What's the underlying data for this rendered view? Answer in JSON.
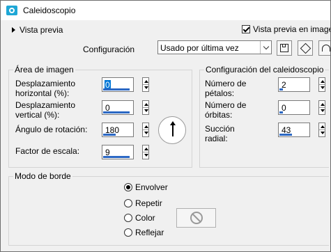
{
  "window": {
    "title": "Caleidoscopio"
  },
  "top": {
    "preview_label": "Vista previa",
    "preview_checkbox_label": "Vista previa en imagen",
    "preview_checked": true
  },
  "config": {
    "label": "Configuración",
    "selected": "Usado por última vez",
    "icons": [
      "save-icon",
      "cube-icon",
      "reset-icon"
    ]
  },
  "image_area": {
    "title": "Área de imagen",
    "fields": [
      {
        "label": "Desplazamiento horizontal (%):",
        "value": "0"
      },
      {
        "label": "Desplazamiento vertical (%):",
        "value": "0"
      },
      {
        "label": "Ángulo de rotación:",
        "value": "180"
      },
      {
        "label": "Factor de escala:",
        "value": "9"
      }
    ]
  },
  "kaleido": {
    "title": "Configuración del caleidoscopio",
    "fields": [
      {
        "label": "Número de pétalos:",
        "value": "2"
      },
      {
        "label": "Número de órbitas:",
        "value": "0"
      },
      {
        "label": "Succión radial:",
        "value": "43"
      }
    ]
  },
  "border": {
    "title": "Modo de borde",
    "options": [
      "Envolver",
      "Repetir",
      "Color",
      "Reflejar"
    ],
    "selected": "Envolver"
  }
}
